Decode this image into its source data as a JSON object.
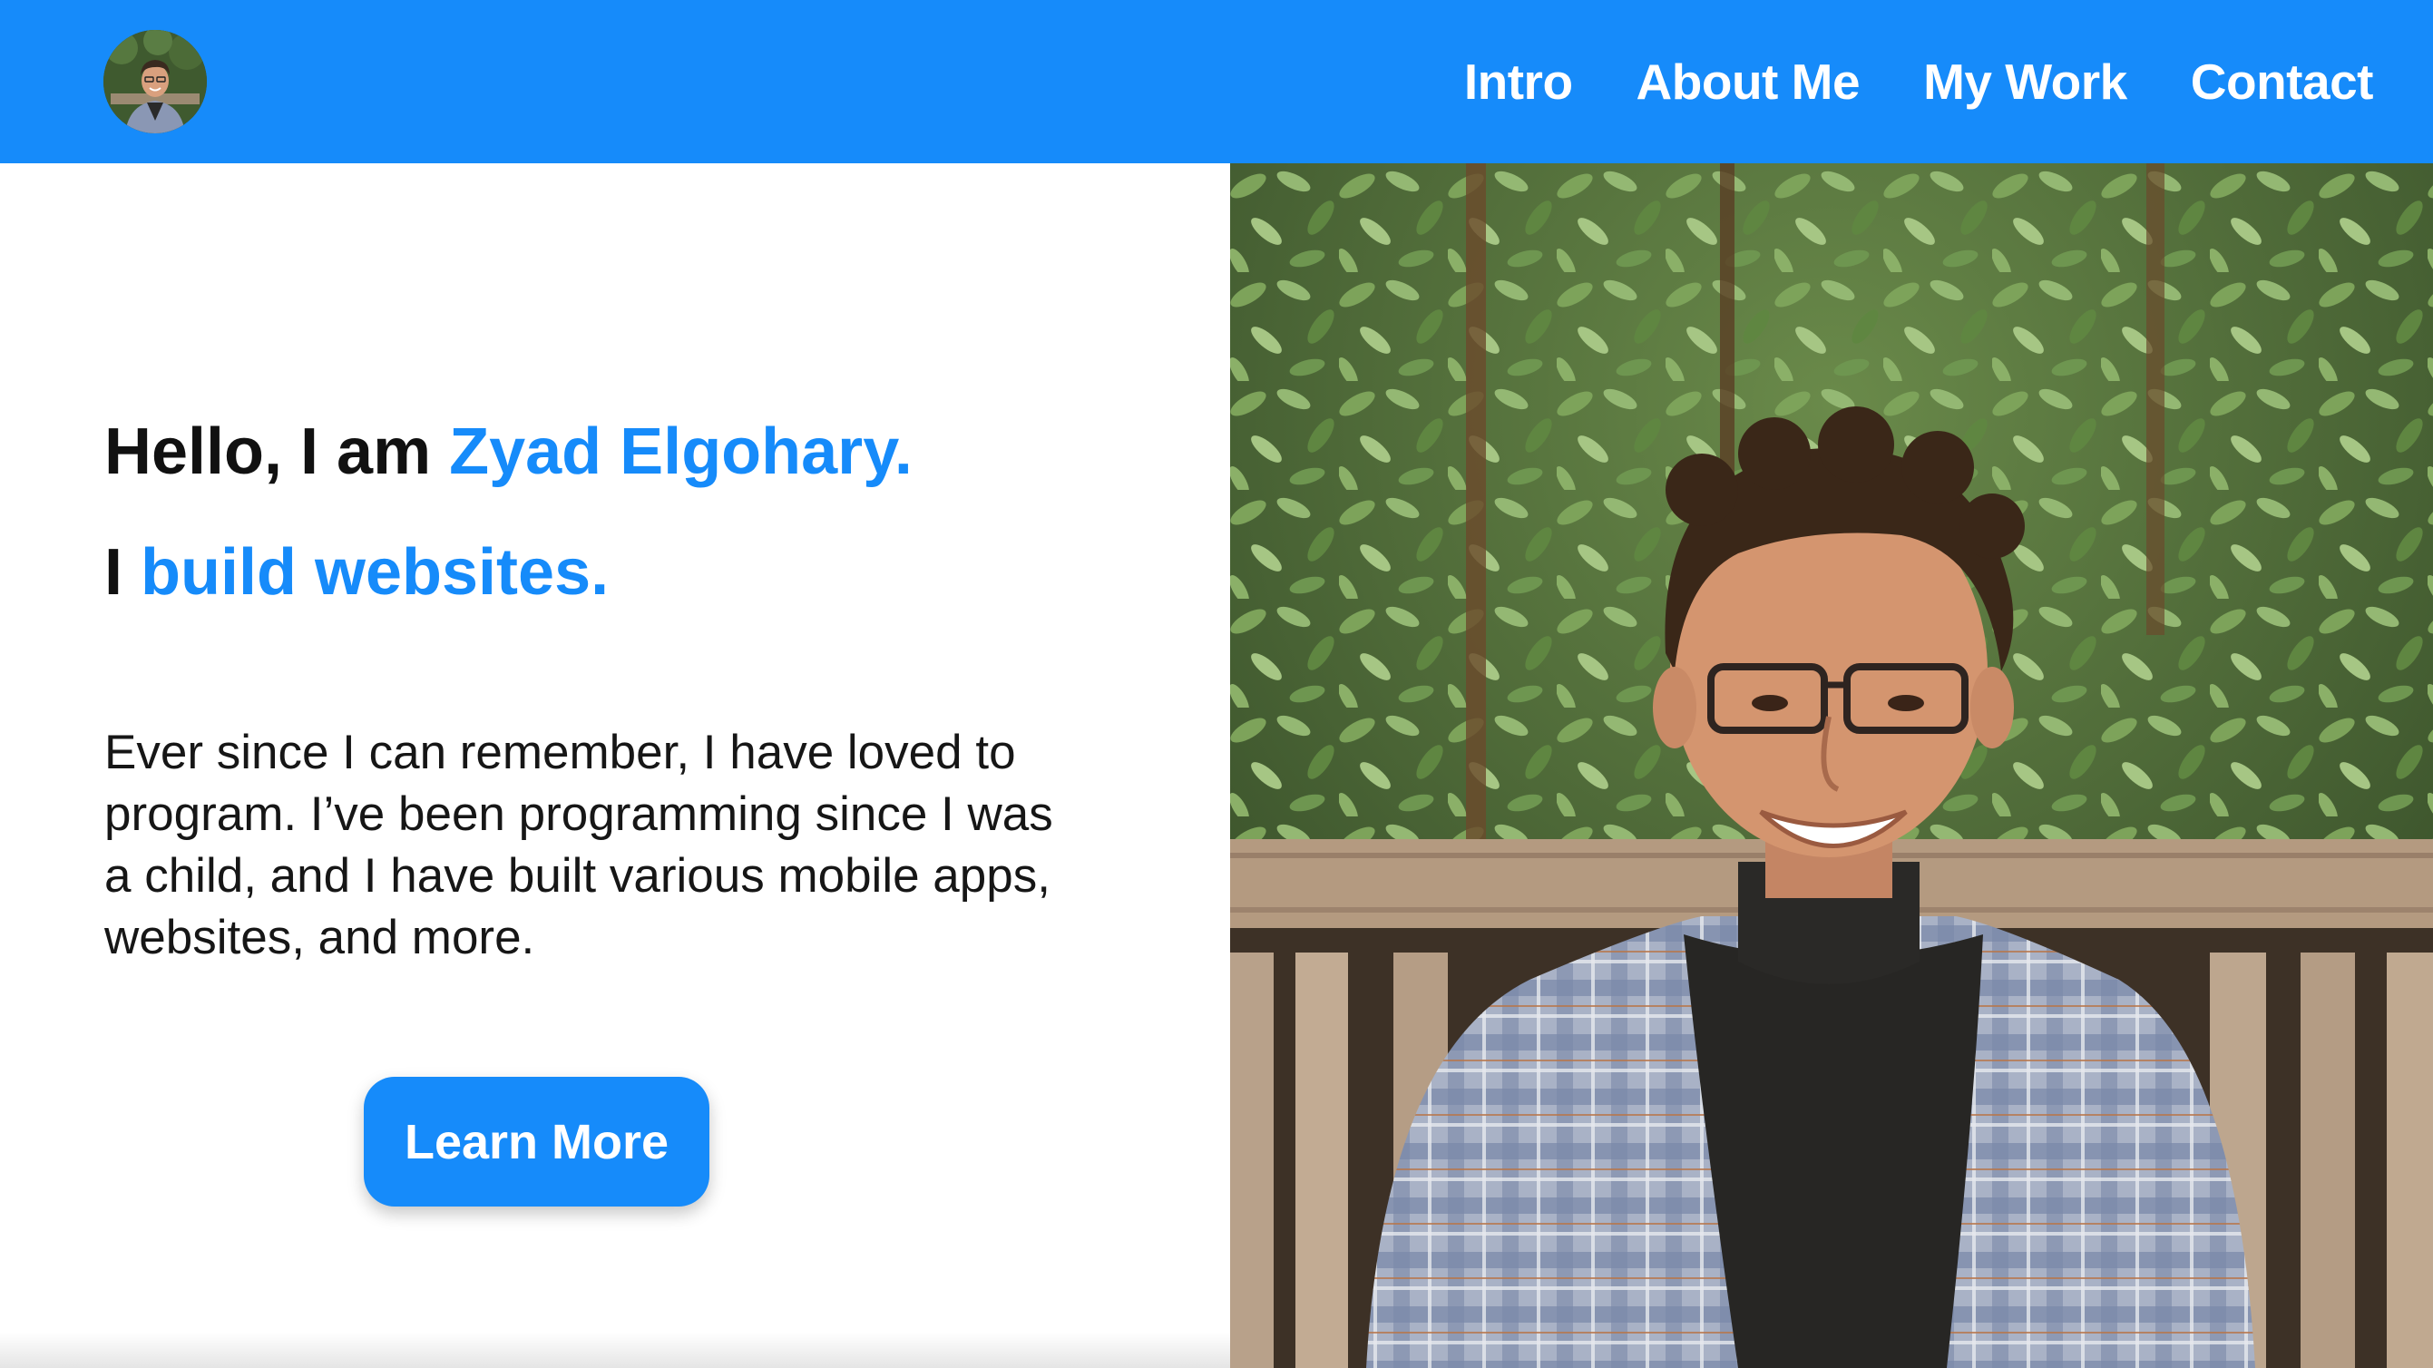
{
  "header": {
    "avatar_alt": "Profile photo",
    "nav": [
      {
        "label": "Intro"
      },
      {
        "label": "About Me"
      },
      {
        "label": "My Work"
      },
      {
        "label": "Contact"
      }
    ]
  },
  "hero": {
    "line1_prefix": "Hello, I am ",
    "line1_name": "Zyad Elgohary.",
    "line2_prefix": "I ",
    "line2_accent": "build websites.",
    "paragraph": "Ever since I can remember, I have loved to program. I’ve been programming since I was a child, and I have built various mobile apps, websites, and more.",
    "cta_label": "Learn More"
  },
  "colors": {
    "brand_blue": "#168bfa",
    "text_dark": "#111111",
    "white": "#ffffff"
  },
  "icons": {
    "avatar": "profile-photo",
    "hero_photo": "portrait-photo"
  }
}
